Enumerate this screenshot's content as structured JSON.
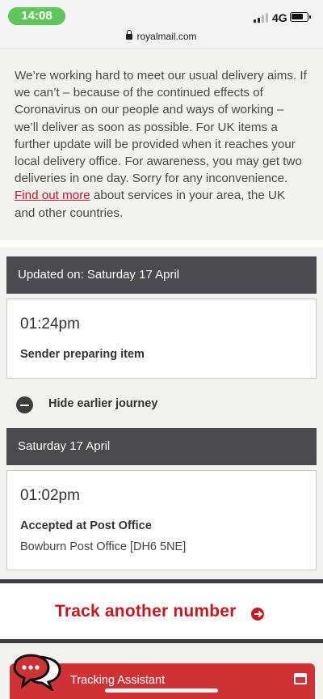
{
  "status_bar": {
    "time": "14:08",
    "network": "4G",
    "url": "royalmail.com"
  },
  "notice": {
    "text_before_link": "We’re working hard to meet our usual delivery aims. If we can’t – because of the continued effects of Coronavirus on our people and ways of working – we’ll deliver as soon as possible. For UK items a further update will be provided when it reaches your local delivery office. For awareness, you may get two deliveries in one day. Sorry for any inconvenience. ",
    "link_text": "Find out more",
    "text_after_link": " about services in your area, the UK and other countries."
  },
  "tracking": {
    "updated_header": "Updated on: Saturday 17 April",
    "latest_event": {
      "time": "01:24pm",
      "status": "Sender preparing item"
    },
    "toggle_label": "Hide earlier journey",
    "earlier_date_header": "Saturday 17 April",
    "earlier_event": {
      "time": "01:02pm",
      "status": "Accepted at Post Office",
      "location": "Bowburn Post Office [DH6 5NE]"
    }
  },
  "track_another": {
    "label": "Track another number"
  },
  "assistant": {
    "label": "Tracking Assistant"
  },
  "colors": {
    "brand_red": "#c8171e",
    "header_dark": "#4b4b4f",
    "status_green": "#5fc65c"
  },
  "icons": [
    "lock-icon",
    "minus-circle-icon",
    "arrow-right-circle-icon",
    "chat-bubbles-icon",
    "window-icon"
  ]
}
